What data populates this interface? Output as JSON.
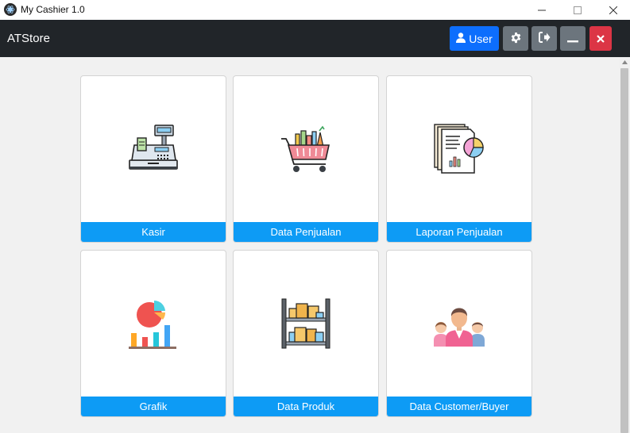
{
  "window": {
    "title": "My Cashier 1.0"
  },
  "navbar": {
    "brand": "ATStore",
    "user_label": "User",
    "colors": {
      "primary": "#0d6efd",
      "secondary": "#6c757d",
      "danger": "#dc3545",
      "dark": "#212529"
    }
  },
  "menu": {
    "accent_color": "#0d9bf5",
    "items": [
      {
        "label": "Kasir",
        "icon": "cash-register-icon"
      },
      {
        "label": "Data Penjualan",
        "icon": "shopping-cart-icon"
      },
      {
        "label": "Laporan Penjualan",
        "icon": "sales-report-icon"
      },
      {
        "label": "Grafik",
        "icon": "chart-icon"
      },
      {
        "label": "Data Produk",
        "icon": "product-shelf-icon"
      },
      {
        "label": "Data Customer/Buyer",
        "icon": "customers-icon"
      }
    ]
  }
}
